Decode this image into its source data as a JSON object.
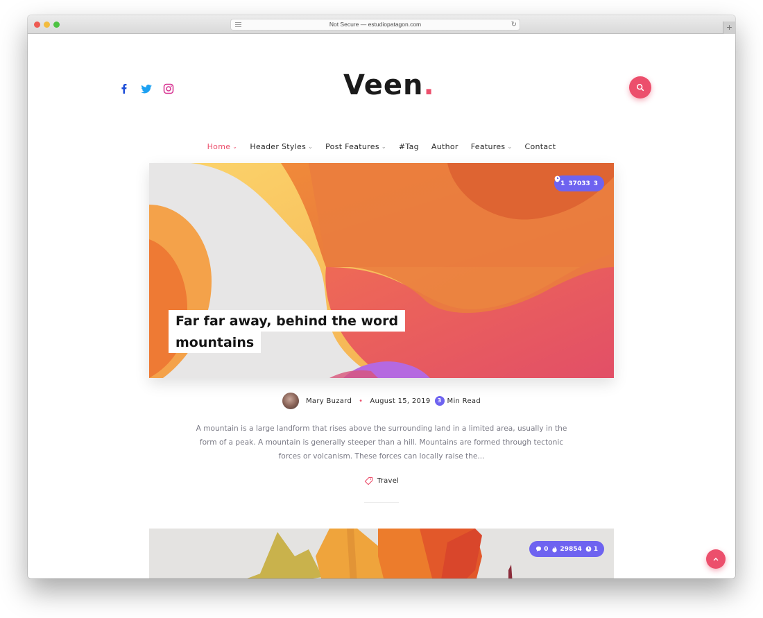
{
  "browser": {
    "address": "Not Secure — estudiopatagon.com",
    "new_tab_label": "+"
  },
  "header": {
    "logo_text": "Veen",
    "logo_dot": ".",
    "social": [
      {
        "name": "facebook",
        "color": "#1d4ed8"
      },
      {
        "name": "twitter",
        "color": "#1da1f2"
      },
      {
        "name": "instagram",
        "color": "#d62f8f"
      }
    ],
    "accent_color": "#ec4f6c"
  },
  "nav": {
    "items": [
      {
        "label": "Home",
        "has_dropdown": true,
        "active": true
      },
      {
        "label": "Header Styles",
        "has_dropdown": true,
        "active": false
      },
      {
        "label": "Post Features",
        "has_dropdown": true,
        "active": false
      },
      {
        "label": "#Tag",
        "has_dropdown": false,
        "active": false
      },
      {
        "label": "Author",
        "has_dropdown": false,
        "active": false
      },
      {
        "label": "Features",
        "has_dropdown": true,
        "active": false
      },
      {
        "label": "Contact",
        "has_dropdown": false,
        "active": false
      }
    ]
  },
  "posts": [
    {
      "title_line1": "Far far away, behind the word",
      "title_line2": "mountains",
      "stats": {
        "comments": "1",
        "views": "37033",
        "read_time": "3"
      },
      "author": "Mary Buzard",
      "separator": "•",
      "date": "August 15, 2019",
      "read_minutes": "3",
      "read_label": "Min Read",
      "excerpt": "A mountain is a large landform that rises above the surrounding land in a limited area, usually in the form of a peak. A mountain is generally steeper than a hill. Mountains are formed through tectonic forces or volcanism. These forces can locally raise the...",
      "tag": "Travel"
    },
    {
      "stats": {
        "comments": "0",
        "views": "29854",
        "read_time": "1"
      }
    }
  ],
  "stats_badge_color": "#6e63f0",
  "back_to_top_icon": "^"
}
